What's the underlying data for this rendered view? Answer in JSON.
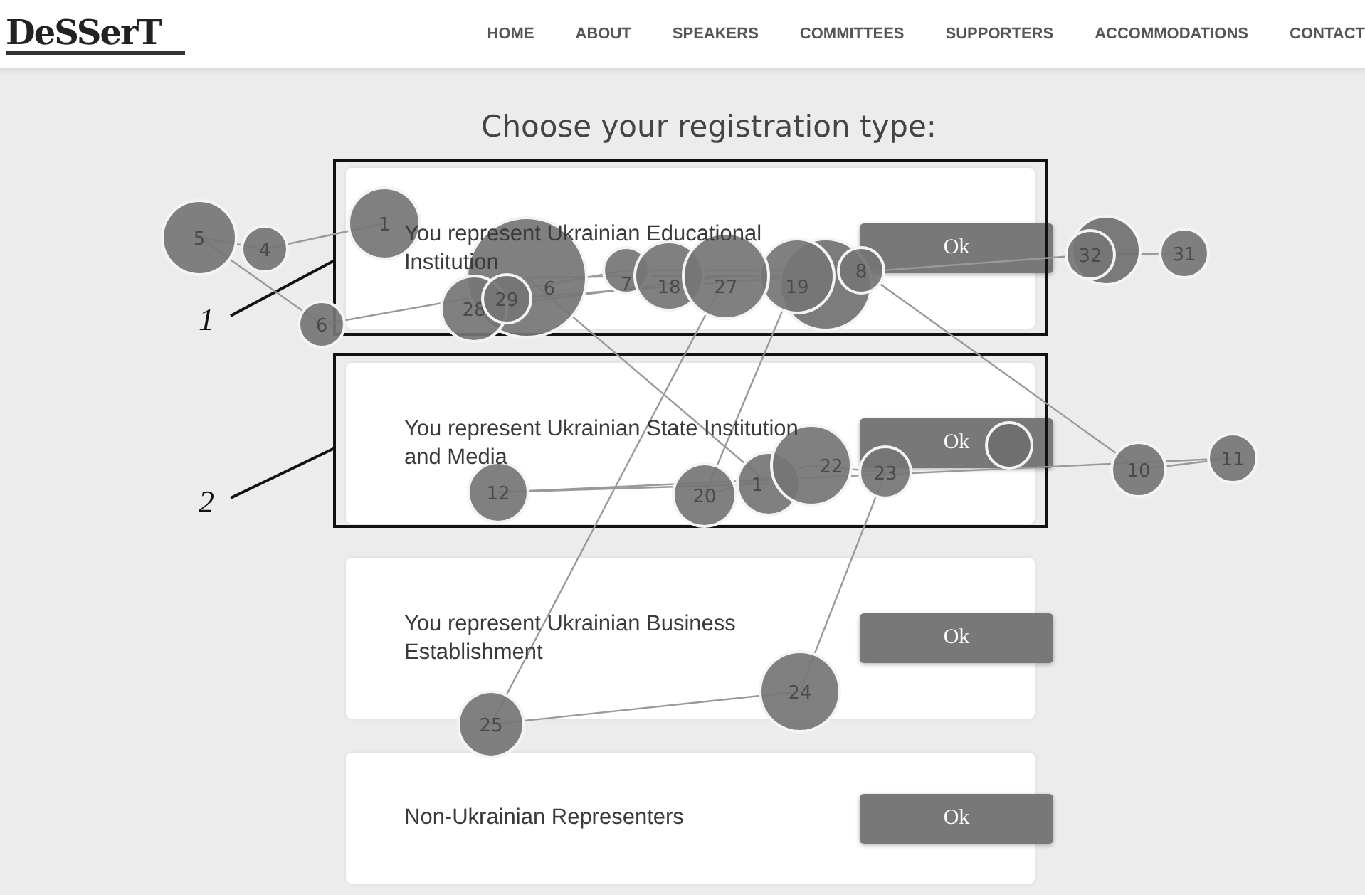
{
  "header": {
    "logo": "DeSSerT",
    "nav": [
      "HOME",
      "ABOUT",
      "SPEAKERS",
      "COMMITTEES",
      "SUPPORTERS",
      "ACCOMMODATIONS",
      "CONTACT"
    ]
  },
  "title": "Choose your registration type:",
  "options": [
    {
      "label": "You represent Ukrainian Educational Institution",
      "button": "Ok"
    },
    {
      "label": "You represent Ukrainian State Institution and Media",
      "button": "Ok"
    },
    {
      "label": "You represent Ukrainian Business Establishment",
      "button": "Ok"
    },
    {
      "label": "Non-Ukrainian Representers",
      "button": "Ok"
    }
  ],
  "callouts": [
    "1",
    "2"
  ],
  "fixations": [
    "1",
    "4",
    "5",
    "6",
    "7",
    "8",
    "10",
    "11",
    "12",
    "1",
    "6",
    "18",
    "19",
    "20",
    "22",
    "23",
    "24",
    "25",
    "27",
    "28",
    "29",
    "32",
    "31"
  ]
}
